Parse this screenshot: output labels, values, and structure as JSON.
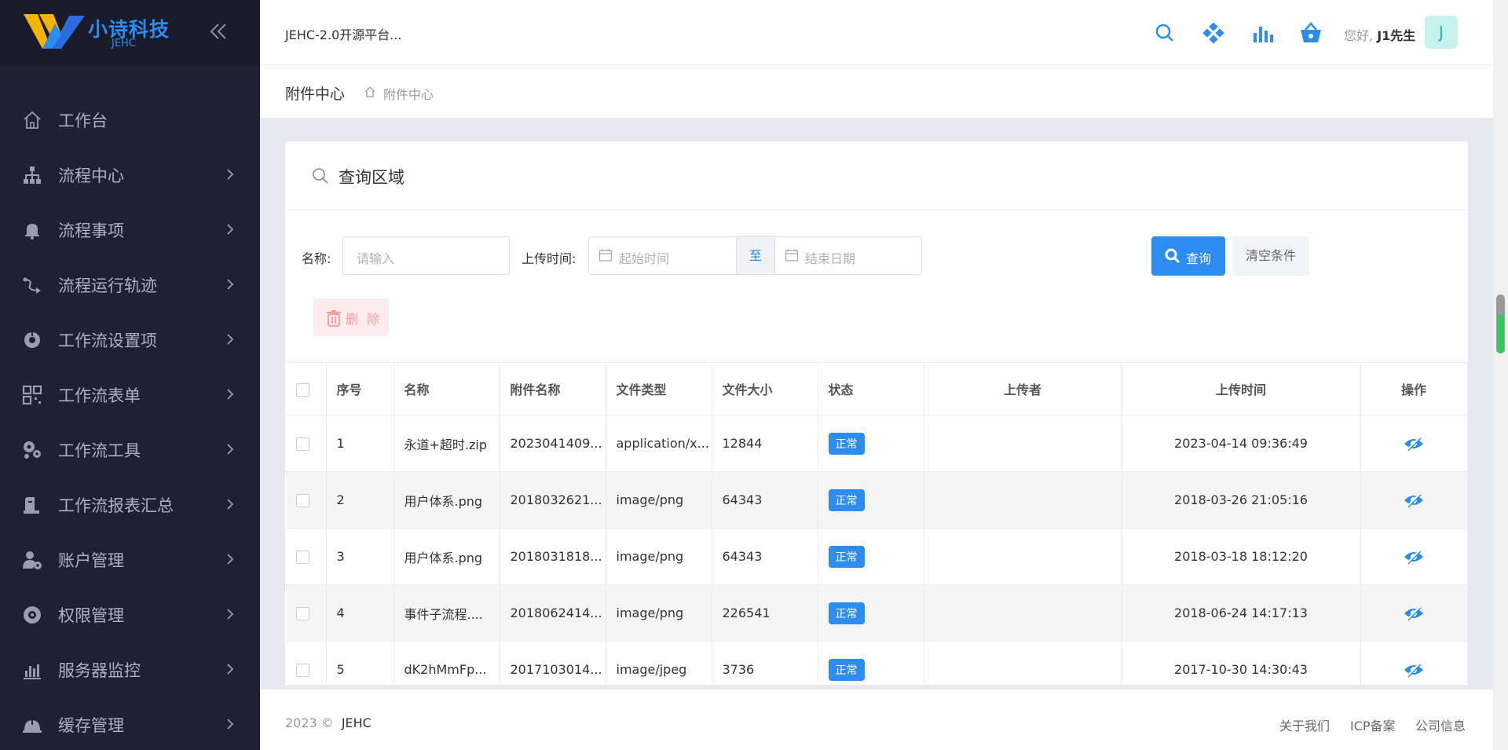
{
  "sidebar": {
    "logo_text": "小诗科技",
    "logo_sub": "JEHC",
    "items": [
      {
        "label": "工作台",
        "icon": "home-icon",
        "arrow": false
      },
      {
        "label": "流程中心",
        "icon": "sitemap-icon",
        "arrow": true
      },
      {
        "label": "流程事项",
        "icon": "bell-icon",
        "arrow": true
      },
      {
        "label": "流程运行轨迹",
        "icon": "route-icon",
        "arrow": true
      },
      {
        "label": "工作流设置项",
        "icon": "settings-icon",
        "arrow": true
      },
      {
        "label": "工作流表单",
        "icon": "qrcode-icon",
        "arrow": true
      },
      {
        "label": "工作流工具",
        "icon": "cogs-icon",
        "arrow": true
      },
      {
        "label": "工作流报表汇总",
        "icon": "report-icon",
        "arrow": true
      },
      {
        "label": "账户管理",
        "icon": "user-gear-icon",
        "arrow": true
      },
      {
        "label": "权限管理",
        "icon": "shield-gear-icon",
        "arrow": true
      },
      {
        "label": "服务器监控",
        "icon": "bar-chart-icon",
        "arrow": true
      },
      {
        "label": "缓存管理",
        "icon": "helmet-icon",
        "arrow": true
      }
    ]
  },
  "header": {
    "platform": "JEHC-2.0开源平台...",
    "greeting_prefix": "您好,",
    "user_name": "J1先生",
    "avatar_letter": "J"
  },
  "breadcrumb": {
    "title": "附件中心",
    "current": "附件中心"
  },
  "query": {
    "title": "查询区域",
    "name_label": "名称:",
    "name_placeholder": "请输入",
    "time_label": "上传时间:",
    "start_placeholder": "起始时间",
    "to_label": "至",
    "end_placeholder": "结束日期",
    "search_label": "查询",
    "clear_label": "清空条件",
    "delete_label": "删 除"
  },
  "table": {
    "headers": [
      "序号",
      "名称",
      "附件名称",
      "文件类型",
      "文件大小",
      "状态",
      "上传者",
      "上传时间",
      "操作"
    ],
    "rows": [
      {
        "no": "1",
        "name": "永道+超时.zip",
        "attach": "2023041409...",
        "type": "application/x...",
        "size": "12844",
        "status": "正常",
        "uploader": "",
        "time": "2023-04-14 09:36:49"
      },
      {
        "no": "2",
        "name": "用户体系.png",
        "attach": "2018032621...",
        "type": "image/png",
        "size": "64343",
        "status": "正常",
        "uploader": "",
        "time": "2018-03-26 21:05:16"
      },
      {
        "no": "3",
        "name": "用户体系.png",
        "attach": "2018031818...",
        "type": "image/png",
        "size": "64343",
        "status": "正常",
        "uploader": "",
        "time": "2018-03-18 18:12:20"
      },
      {
        "no": "4",
        "name": "事件子流程....",
        "attach": "2018062414...",
        "type": "image/png",
        "size": "226541",
        "status": "正常",
        "uploader": "",
        "time": "2018-06-24 14:17:13"
      },
      {
        "no": "5",
        "name": "dK2hMmFp...",
        "attach": "2017103014...",
        "type": "image/jpeg",
        "size": "3736",
        "status": "正常",
        "uploader": "",
        "time": "2017-10-30 14:30:43"
      }
    ]
  },
  "footer": {
    "year": "2023 ©",
    "brand": "JEHC",
    "links": [
      "关于我们",
      "ICP备案",
      "公司信息"
    ]
  },
  "colors": {
    "sidebar_bg": "#1f2031",
    "accent": "#2d8cf0",
    "logo": "#2a8bf0"
  }
}
